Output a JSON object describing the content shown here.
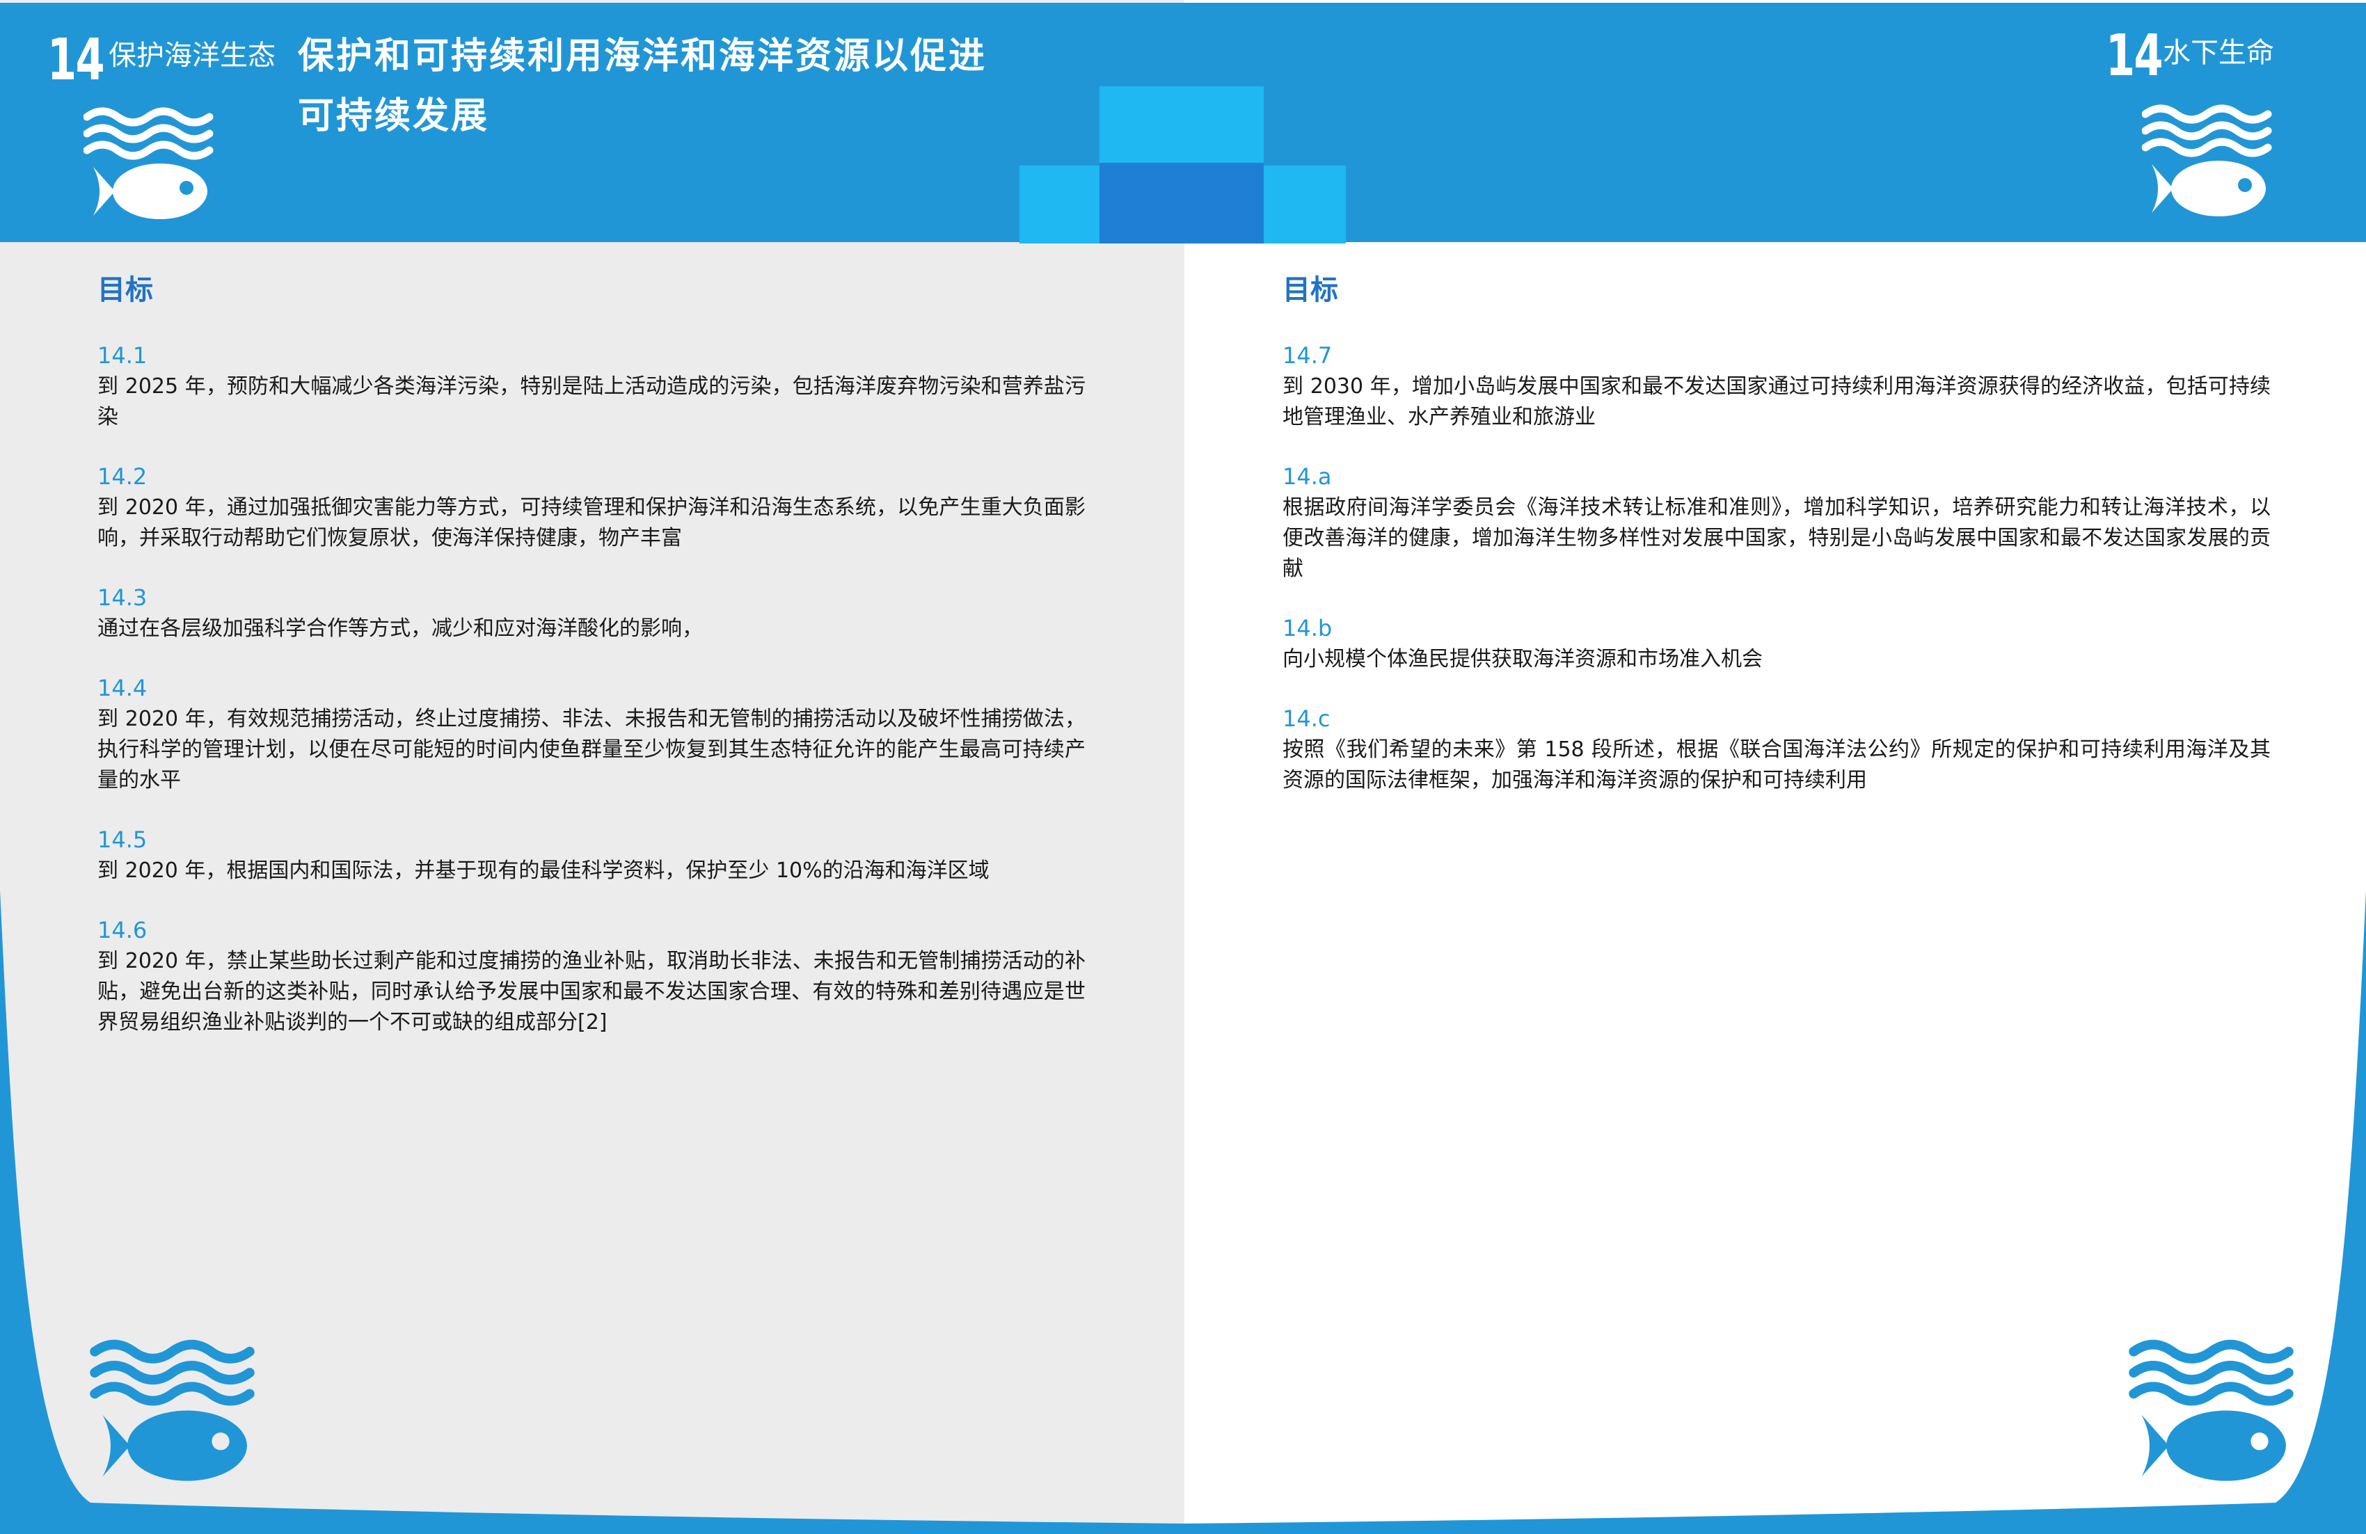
{
  "header": {
    "left_goal_number": "14",
    "left_goal_name": "保护海洋生态",
    "title_line1": "保护和可持续利用海洋和海洋资源以促进",
    "title_line2": "可持续发展",
    "right_goal_number": "14",
    "right_goal_name": "水下生命"
  },
  "left_page": {
    "section_title": "目标",
    "targets": [
      {
        "num": "14.1",
        "text": "到 2025 年，预防和大幅减少各类海洋污染，特别是陆上活动造成的污染，包括海洋废弃物污染和营养盐污染"
      },
      {
        "num": "14.2",
        "text": "到 2020 年，通过加强抵御灾害能力等方式，可持续管理和保护海洋和沿海生态系统，以免产生重大负面影响，并采取行动帮助它们恢复原状，使海洋保持健康，物产丰富"
      },
      {
        "num": "14.3",
        "text": "通过在各层级加强科学合作等方式，减少和应对海洋酸化的影响，"
      },
      {
        "num": "14.4",
        "text": "到 2020 年，有效规范捕捞活动，终止过度捕捞、非法、未报告和无管制的捕捞活动以及破坏性捕捞做法，执行科学的管理计划，以便在尽可能短的时间内使鱼群量至少恢复到其生态特征允许的能产生最高可持续产量的水平"
      },
      {
        "num": "14.5",
        "text": "到 2020 年，根据国内和国际法，并基于现有的最佳科学资料，保护至少 10%的沿海和海洋区域"
      },
      {
        "num": "14.6",
        "text": "到 2020 年，禁止某些助长过剩产能和过度捕捞的渔业补贴，取消助长非法、未报告和无管制捕捞活动的补贴，避免出台新的这类补贴，同时承认给予发展中国家和最不发达国家合理、有效的特殊和差别待遇应是世界贸易组织渔业补贴谈判的一个不可或缺的组成部分[2]"
      }
    ]
  },
  "right_page": {
    "section_title": "目标",
    "targets": [
      {
        "num": "14.7",
        "text": "到 2030 年，增加小岛屿发展中国家和最不发达国家通过可持续利用海洋资源获得的经济收益，包括可持续地管理渔业、水产养殖业和旅游业"
      },
      {
        "num": "14.a",
        "text": "根据政府间海洋学委员会《海洋技术转让标准和准则》，增加科学知识，培养研究能力和转让海洋技术，以便改善海洋的健康，增加海洋生物多样性对发展中国家，特别是小岛屿发展中国家和最不发达国家发展的贡献"
      },
      {
        "num": "14.b",
        "text": "向小规模个体渔民提供获取海洋资源和市场准入机会"
      },
      {
        "num": "14.c",
        "text": "按照《我们希望的未来》第 158 段所述，根据《联合国海洋法公约》所规定的保护和可持续利用海洋及其资源的国际法律框架，加强海洋和海洋资源的保护和可持续利用"
      }
    ]
  },
  "colors": {
    "brand_blue": "#2196d6",
    "heading_blue": "#2173c4",
    "light_cyan": "#1fb8f3",
    "deep_blue": "#1f7fd4",
    "left_page_bg": "#ececec"
  },
  "icons": [
    "waves-fish-icon"
  ]
}
